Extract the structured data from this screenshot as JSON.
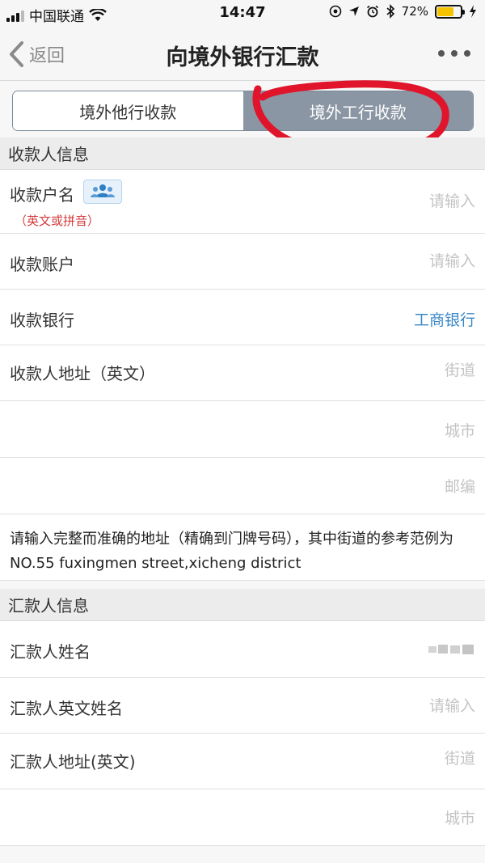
{
  "status_bar": {
    "carrier": "中国联通",
    "time": "14:47",
    "battery_percent": "72%",
    "battery_level": 0.72
  },
  "nav": {
    "back_label": "返回",
    "title": "向境外银行汇款"
  },
  "segment": {
    "tabs": [
      {
        "label": "境外他行收款",
        "selected": false
      },
      {
        "label": "境外工行收款",
        "selected": true
      }
    ]
  },
  "annotation_color": "#e0142b",
  "payee_section": {
    "header": "收款人信息",
    "name_label": "收款户名",
    "name_hint": "（英文或拼音）",
    "name_placeholder": "请输入",
    "account_label": "收款账户",
    "account_placeholder": "请输入",
    "bank_label": "收款银行",
    "bank_value": "工商银行",
    "address_label": "收款人地址（英文）",
    "street_placeholder": "街道",
    "city_placeholder": "城市",
    "postcode_placeholder": "邮编",
    "address_note": "请输入完整而准确的地址（精确到门牌号码），其中街道的参考范例为NO.55 fuxingmen street,xicheng district"
  },
  "remitter_section": {
    "header": "汇款人信息",
    "name_label": "汇款人姓名",
    "english_name_label": "汇款人英文姓名",
    "english_name_placeholder": "请输入",
    "address_label": "汇款人地址(英文)",
    "street_placeholder": "街道",
    "city_placeholder": "城市"
  },
  "icons": [
    "signal-icon",
    "wifi-icon",
    "location-icon",
    "alarm-icon",
    "bluetooth-icon",
    "battery-icon",
    "chevron-left-icon",
    "more-icon",
    "contacts-icon"
  ]
}
